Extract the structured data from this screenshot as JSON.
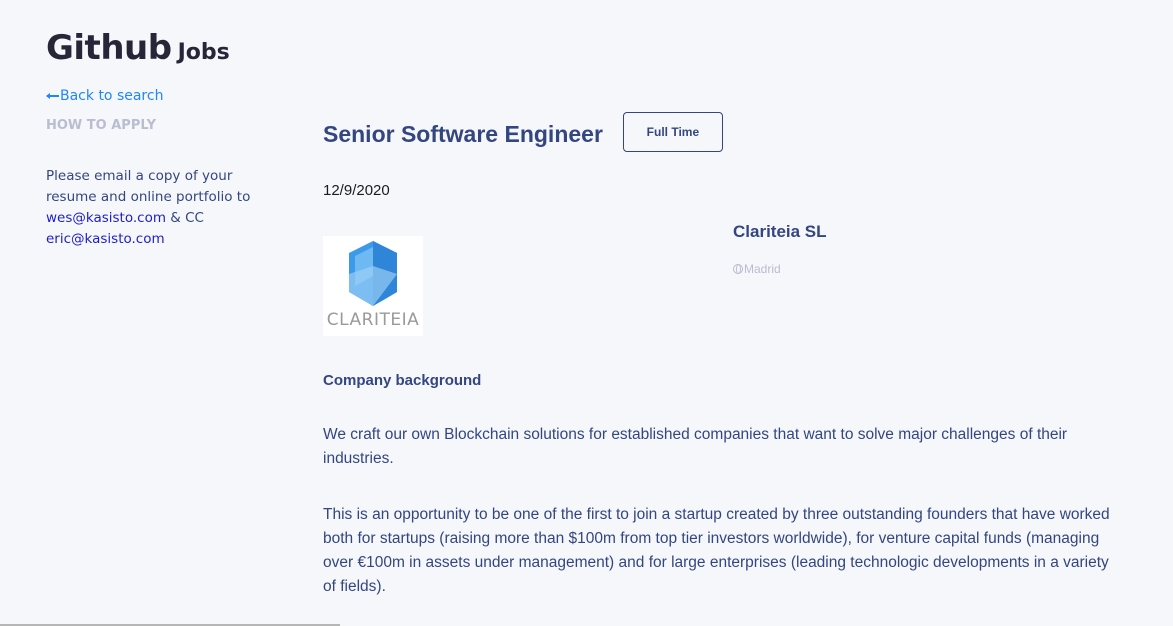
{
  "brand": {
    "main": "Github",
    "sub": "Jobs"
  },
  "sidebar": {
    "back_label": "Back to search",
    "how_to_apply": "HOW TO APPLY",
    "apply_text_before": "Please email a copy of your resume and online portfolio to ",
    "email_1": "wes@kasisto.com",
    "apply_text_middle": " & CC ",
    "email_2": "eric@kasisto.com"
  },
  "job": {
    "title": "Senior Software Engineer",
    "type": "Full Time",
    "date": "12/9/2020",
    "company": "Clariteia SL",
    "location": "Madrid",
    "logo_text": "CLARITEIA"
  },
  "description": {
    "heading": "Company background",
    "paragraph_1": "We craft our own Blockchain solutions for established companies that want to solve major challenges of their industries.",
    "paragraph_2": "This is an opportunity to be one of the first to join a startup created by three outstanding founders that have worked both for startups (raising more than $100m from top tier investors worldwide), for venture capital funds (managing over €100m in assets under management) and for large enterprises (leading technologic developments in a variety of fields)."
  },
  "colors": {
    "accent": "#1e86ff",
    "text": "#334680",
    "muted": "#b9bdcf",
    "background": "#f6f7fb"
  },
  "icons": {
    "back": "arrow-left-icon",
    "location": "globe-icon"
  }
}
